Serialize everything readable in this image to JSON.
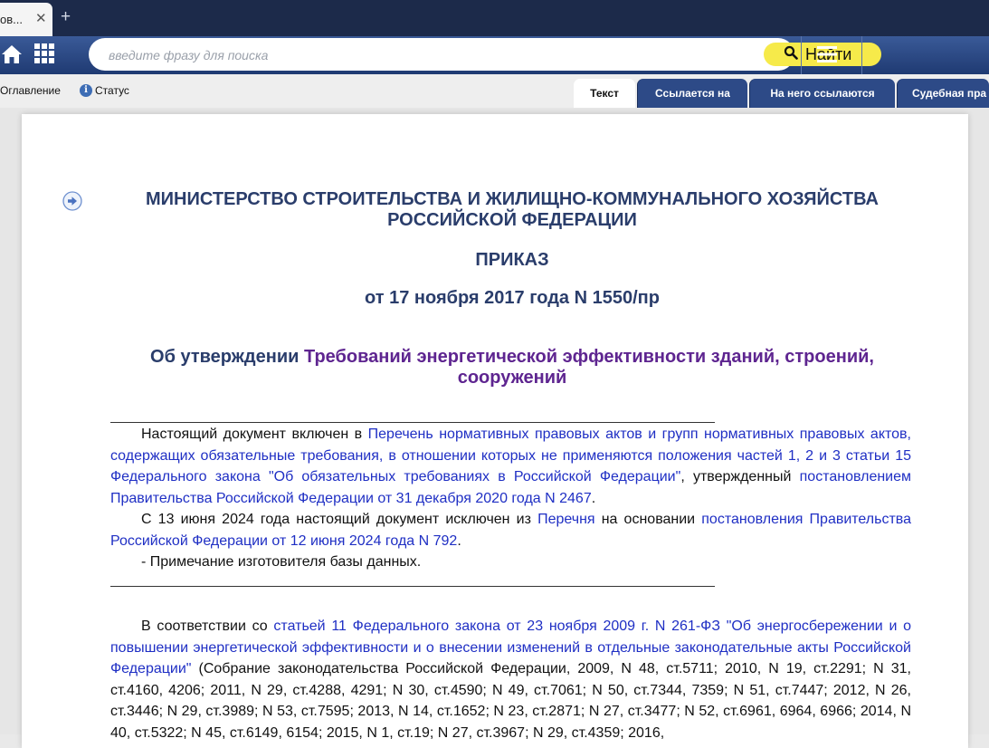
{
  "browser": {
    "active_tab_title": "ов...",
    "close_glyph": "✕",
    "new_tab_glyph": "+"
  },
  "toolbar": {
    "search_placeholder": "введите фразу для поиска",
    "search_button_label": "Найти",
    "icons": [
      "home-icon",
      "grid-icon",
      "search-icon",
      "menu-icon"
    ]
  },
  "subbar": {
    "contents_label": "Оглавление",
    "status_label": "Статус",
    "status_icon_glyph": "i",
    "doc_tabs": [
      {
        "label": "Текст",
        "active": true
      },
      {
        "label": "Ссылается на",
        "active": false
      },
      {
        "label": "На него ссылаются",
        "active": false
      },
      {
        "label": "Судебная пра",
        "active": false
      }
    ]
  },
  "document": {
    "ministry_line1": "МИНИСТЕРСТВО СТРОИТЕЛЬСТВА И ЖИЛИЩНО-КОММУНАЛЬНОГО ХОЗЯЙСТВА",
    "ministry_line2": "РОССИЙСКОЙ ФЕДЕРАЦИИ",
    "order_title": "ПРИКАЗ",
    "order_date": "от 17 ноября 2017 года N 1550/пр",
    "subject_prefix": "Об утверждении ",
    "subject_link_line1": "Требований энергетической эффективности зданий, строений,",
    "subject_link_line2": "сооружений",
    "note": {
      "p1_t1": "Настоящий документ включен в ",
      "p1_link1": "Перечень нормативных правовых актов и групп нормативных правовых актов, содержащих обязательные требования, в отношении которых не применяются положения частей 1, 2 и 3 статьи 15 Федерального закона \"Об обязательных требованиях в Российской Федерации\"",
      "p1_t2": ", утвержденный ",
      "p1_link2": "постановлением Правительства Российской Федерации от 31 декабря 2020 года N 2467",
      "p1_t3": ".",
      "p2_t1": "С 13 июня 2024 года настоящий документ исключен из ",
      "p2_link1": "Перечня",
      "p2_t2": " на основании ",
      "p2_link2": "постановления Правительства Российской Федерации от 12 июня 2024 года N 792",
      "p2_t3": ".",
      "p3": "- Примечание изготовителя базы данных."
    },
    "body": {
      "t1": "В соответствии со ",
      "link1": "статьей 11 Федерального закона от 23 ноября 2009 г. N 261-ФЗ \"Об энергосбережении и о повышении энергетической эффективности и о внесении изменений в отдельные законодательные акты Российской Федерации\"",
      "t2": " (Собрание законодательства Российской Федерации, 2009, N 48, ст.5711; 2010, N 19, ст.2291; N 31, ст.4160, 4206; 2011, N 29, ст.4288, 4291; N 30, ст.4590; N 49, ст.7061; N 50, ст.7344, 7359; N 51, ст.7447; 2012, N 26, ст.3446; N 29, ст.3989; N 53, ст.7595; 2013, N 14, ст.1652; N 23, ст.2871; N 27, ст.3477; N 52, ст.6961, 6964, 6966; 2014, N 40, ст.5322; N 45, ст.6149, 6154; 2015, N 1, ст.19; N 27, ст.3967; N 29, ст.4359; 2016,"
    }
  },
  "colors": {
    "tabstrip_bg": "#1c2a4a",
    "toolbar_bg": "#2b4a86",
    "search_button_bg": "#f6ea4a",
    "heading_text": "#2a3d6b",
    "link_blue": "#1f2fc4",
    "link_purple": "#5e2590"
  }
}
